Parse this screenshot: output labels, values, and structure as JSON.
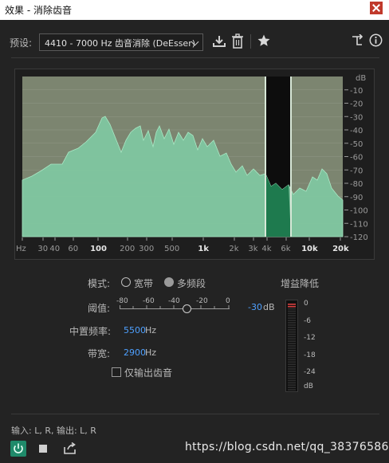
{
  "window": {
    "title": "效果 - 消除齿音"
  },
  "preset": {
    "label": "预设:",
    "value": "4410 - 7000 Hz 齿音消除 (DeEsser)"
  },
  "graph": {
    "db_unit": "dB",
    "db_ticks": [
      "-10",
      "-20",
      "-30",
      "-40",
      "-50",
      "-60",
      "-70",
      "-80",
      "-90",
      "-100",
      "-110",
      "-120"
    ],
    "freq_ticks": [
      {
        "label": "Hz",
        "major": false
      },
      {
        "label": "30",
        "major": false
      },
      {
        "label": "40",
        "major": false
      },
      {
        "label": "60",
        "major": false
      },
      {
        "label": "100",
        "major": true
      },
      {
        "label": "200",
        "major": false
      },
      {
        "label": "300",
        "major": false
      },
      {
        "label": "500",
        "major": false
      },
      {
        "label": "1k",
        "major": true
      },
      {
        "label": "2k",
        "major": false
      },
      {
        "label": "3k",
        "major": false
      },
      {
        "label": "4k",
        "major": false
      },
      {
        "label": "6k",
        "major": false
      },
      {
        "label": "10k",
        "major": true
      },
      {
        "label": "20k",
        "major": true
      }
    ],
    "colors": {
      "plot_bg": "#7c8570",
      "spectrum": "#7fc6a0",
      "band_bg": "#0d0d0d",
      "band_fill": "#1e7a4e",
      "marker": "#d8e8d8"
    }
  },
  "controls": {
    "mode_label": "模式:",
    "mode_options": [
      {
        "label": "宽带",
        "checked": false
      },
      {
        "label": "多频段",
        "checked": true
      }
    ],
    "threshold_label": "阈值:",
    "threshold_scale": [
      "-80",
      "-60",
      "-40",
      "-20",
      "0"
    ],
    "threshold_value": "-30",
    "threshold_unit": "dB",
    "center_freq_label": "中置频率:",
    "center_freq_value": "5500",
    "center_freq_unit": "Hz",
    "bandwidth_label": "带宽:",
    "bandwidth_value": "2900",
    "bandwidth_unit": "Hz",
    "output_only_label": "仅输出齿音",
    "output_only_checked": false
  },
  "gain_reduction": {
    "title": "增益降低",
    "scale": [
      "0",
      "-6",
      "-12",
      "-18",
      "-24",
      "dB"
    ]
  },
  "footer": {
    "io_text": "输入: L, R,  输出: L, R"
  },
  "watermark": "https://blog.csdn.net/qq_38376586"
}
